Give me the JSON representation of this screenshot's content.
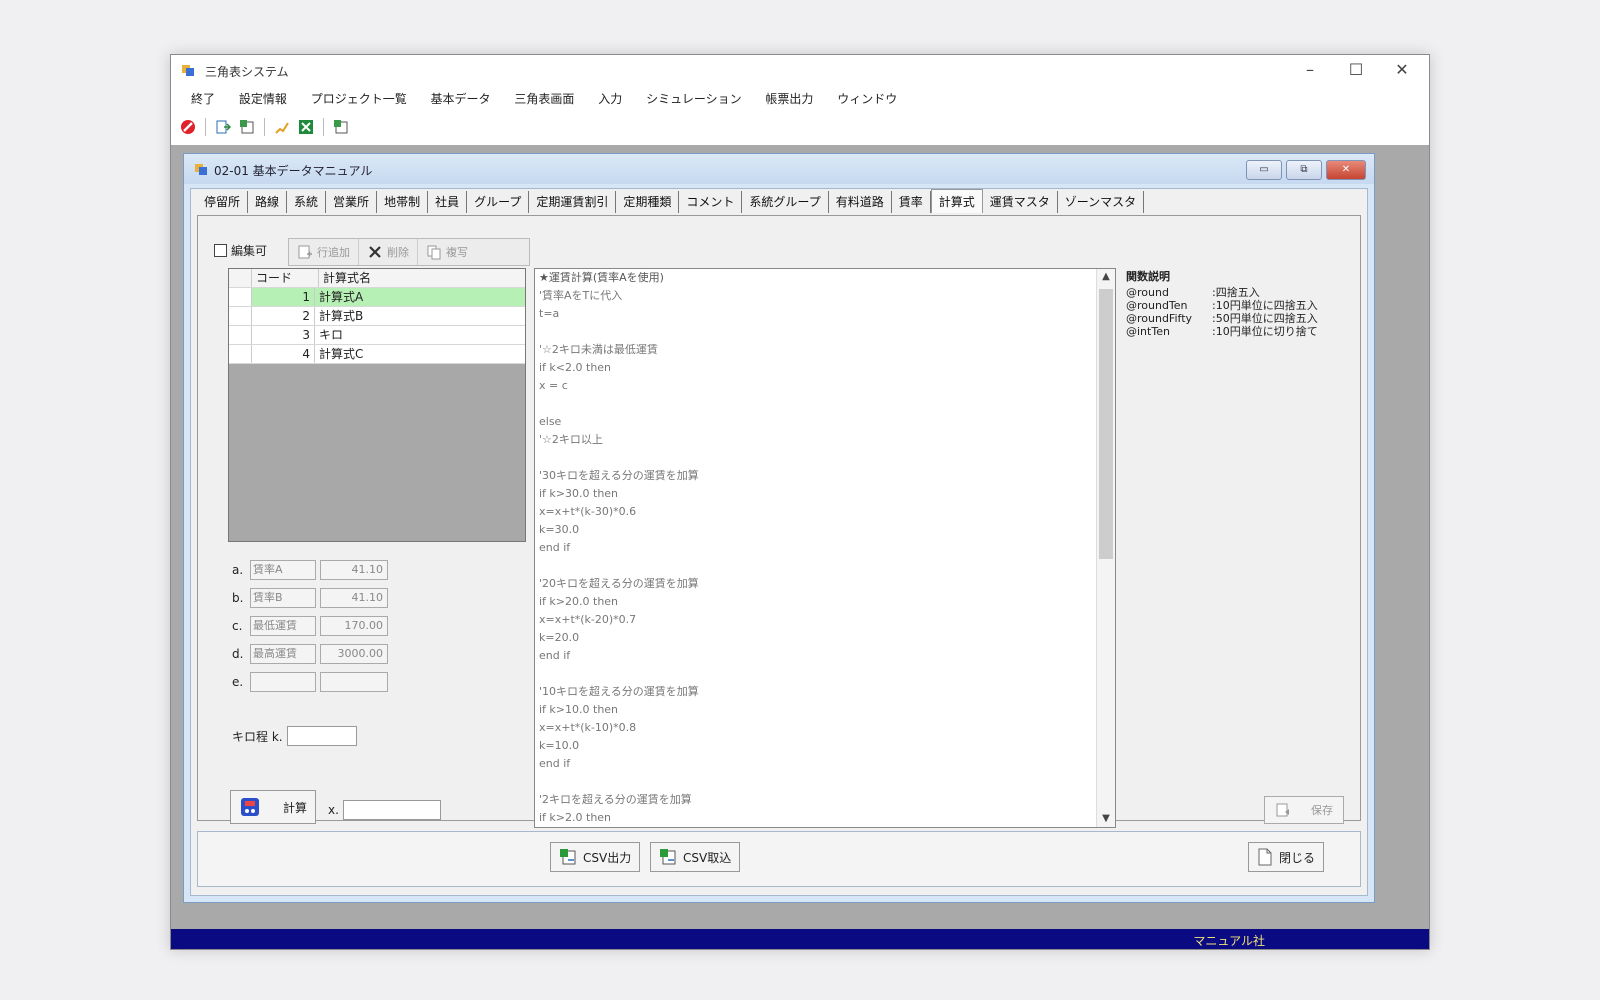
{
  "app": {
    "title": "三角表システム",
    "controls": {
      "minimize": "–",
      "maximize": "☐",
      "close": "✕"
    }
  },
  "menu": {
    "items": [
      "終了",
      "設定情報",
      "プロジェクト一覧",
      "基本データ",
      "三角表画面",
      "入力",
      "シミュレーション",
      "帳票出力",
      "ウィンドウ"
    ]
  },
  "child": {
    "title": "02-01 基本データマニュアル",
    "tabs": [
      "停留所",
      "路線",
      "系統",
      "営業所",
      "地帯制",
      "社員",
      "グループ",
      "定期運賃割引",
      "定期種類",
      "コメント",
      "系統グループ",
      "有料道路",
      "賃率",
      "計算式",
      "運賃マスタ",
      "ゾーンマスタ"
    ],
    "active_tab": "計算式",
    "edit_label": "編集可",
    "toolbar": {
      "add": "行追加",
      "delete": "削除",
      "copy": "複写"
    },
    "grid": {
      "headers": [
        "コード",
        "計算式名"
      ],
      "rows": [
        {
          "code": "1",
          "name": "計算式A"
        },
        {
          "code": "2",
          "name": "計算式B"
        },
        {
          "code": "3",
          "name": "キロ"
        },
        {
          "code": "4",
          "name": "計算式C"
        }
      ]
    },
    "params": [
      {
        "letter": "a.",
        "label": "賃率A",
        "value": "41.10"
      },
      {
        "letter": "b.",
        "label": "賃率B",
        "value": "41.10"
      },
      {
        "letter": "c.",
        "label": "最低運賃",
        "value": "170.00"
      },
      {
        "letter": "d.",
        "label": "最高運賃",
        "value": "3000.00"
      },
      {
        "letter": "e.",
        "label": "",
        "value": ""
      }
    ],
    "k_label": "キロ程 k.",
    "calc_label": "計算",
    "x_label": "x.",
    "code_lines": [
      "★運賃計算(賃率Aを使用)",
      "'賃率AをTに代入",
      "t=a",
      "",
      "'☆2キロ未満は最低運賃",
      "if k<2.0 then",
      "x = c",
      "",
      "else",
      "'☆2キロ以上",
      "",
      "'30キロを超える分の運賃を加算",
      "if k>30.0 then",
      "x=x+t*(k-30)*0.6",
      "k=30.0",
      "end if",
      "",
      "'20キロを超える分の運賃を加算",
      "if k>20.0 then",
      "x=x+t*(k-20)*0.7",
      "k=20.0",
      "end if",
      "",
      "'10キロを超える分の運賃を加算",
      "if k>10.0 then",
      "x=x+t*(k-10)*0.8",
      "k=10.0",
      "end if",
      "",
      "'2キロを超える分の運賃を加算",
      "if k>2.0 then"
    ],
    "func_desc": {
      "title": "関数説明",
      "items": [
        {
          "name": "@round",
          "desc": ":四捨五入"
        },
        {
          "name": "@roundTen",
          "desc": ":10円単位に四捨五入"
        },
        {
          "name": "@roundFifty",
          "desc": ":50円単位に四捨五入"
        },
        {
          "name": "@intTen",
          "desc": ":10円単位に切り捨て"
        }
      ]
    },
    "save_label": "保存",
    "csv_out": "CSV出力",
    "csv_in": "CSV取込",
    "close_label": "閉じる"
  },
  "status": {
    "text": "マニュアル社"
  },
  "colors": {
    "statusbar": "#0a0a82",
    "status_text": "#f0e27a",
    "selected_row": "#b7f0b5"
  }
}
